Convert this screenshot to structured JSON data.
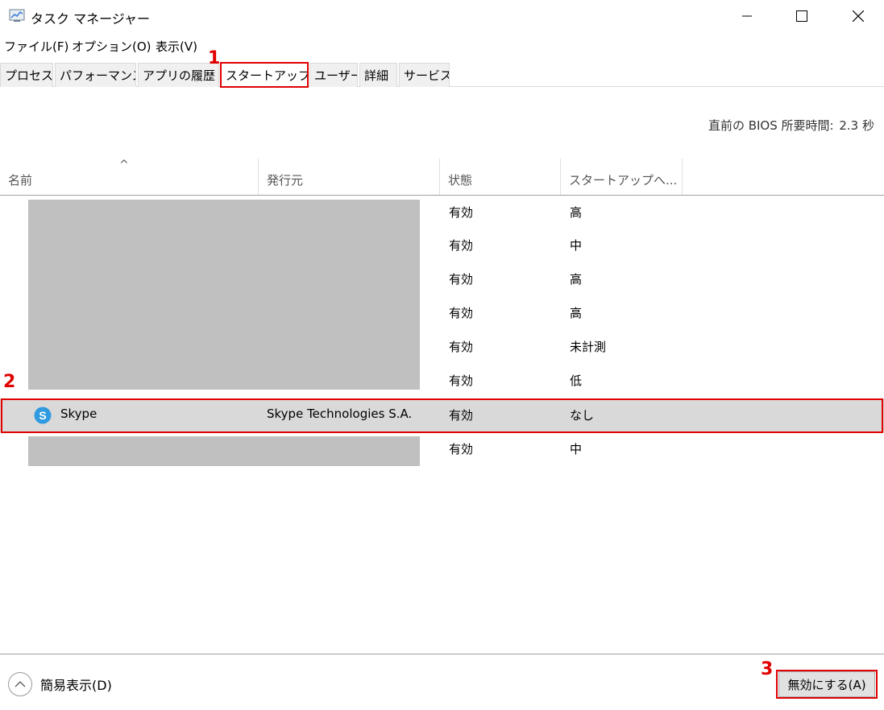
{
  "window": {
    "title": "タスク マネージャー",
    "controls": {
      "minimize": "—",
      "maximize": "☐",
      "close": "✕"
    }
  },
  "menu": [
    "ファイル(F)",
    "オプション(O)",
    "表示(V)"
  ],
  "tabs": [
    {
      "label": "プロセス",
      "active": false
    },
    {
      "label": "パフォーマンス",
      "active": false
    },
    {
      "label": "アプリの履歴",
      "active": false
    },
    {
      "label": "スタートアップ",
      "active": true
    },
    {
      "label": "ユーザー",
      "active": false
    },
    {
      "label": "詳細",
      "active": false
    },
    {
      "label": "サービス",
      "active": false
    }
  ],
  "bios": {
    "label": "直前の BIOS 所要時間:",
    "value": "2.3 秒"
  },
  "columns": {
    "sort_indicator": "^",
    "name": "名前",
    "publisher": "発行元",
    "status": "状態",
    "impact": "スタートアップへ..."
  },
  "rows": [
    {
      "name": "",
      "publisher": "",
      "status": "有効",
      "impact": "高"
    },
    {
      "name": "",
      "publisher": "",
      "status": "有効",
      "impact": "中"
    },
    {
      "name": "",
      "publisher": "",
      "status": "有効",
      "impact": "高"
    },
    {
      "name": "",
      "publisher": "",
      "status": "有効",
      "impact": "高"
    },
    {
      "name": "",
      "publisher": "",
      "status": "有効",
      "impact": "未計測"
    },
    {
      "name": "",
      "publisher": "",
      "status": "有効",
      "impact": "低"
    },
    {
      "name": "Skype",
      "publisher": "Skype Technologies S.A.",
      "status": "有効",
      "impact": "なし",
      "icon": "skype-icon",
      "selected": true
    },
    {
      "name": "",
      "publisher": "",
      "status": "有効",
      "impact": "中"
    }
  ],
  "footer": {
    "fewer_details": "簡易表示(D)",
    "disable_button": "無効にする(A)"
  },
  "callouts": [
    "1",
    "2",
    "3"
  ],
  "colors": {
    "callout": "#e00000",
    "skype": "#2f9ae0",
    "selected_row": "#d9d9d9"
  }
}
